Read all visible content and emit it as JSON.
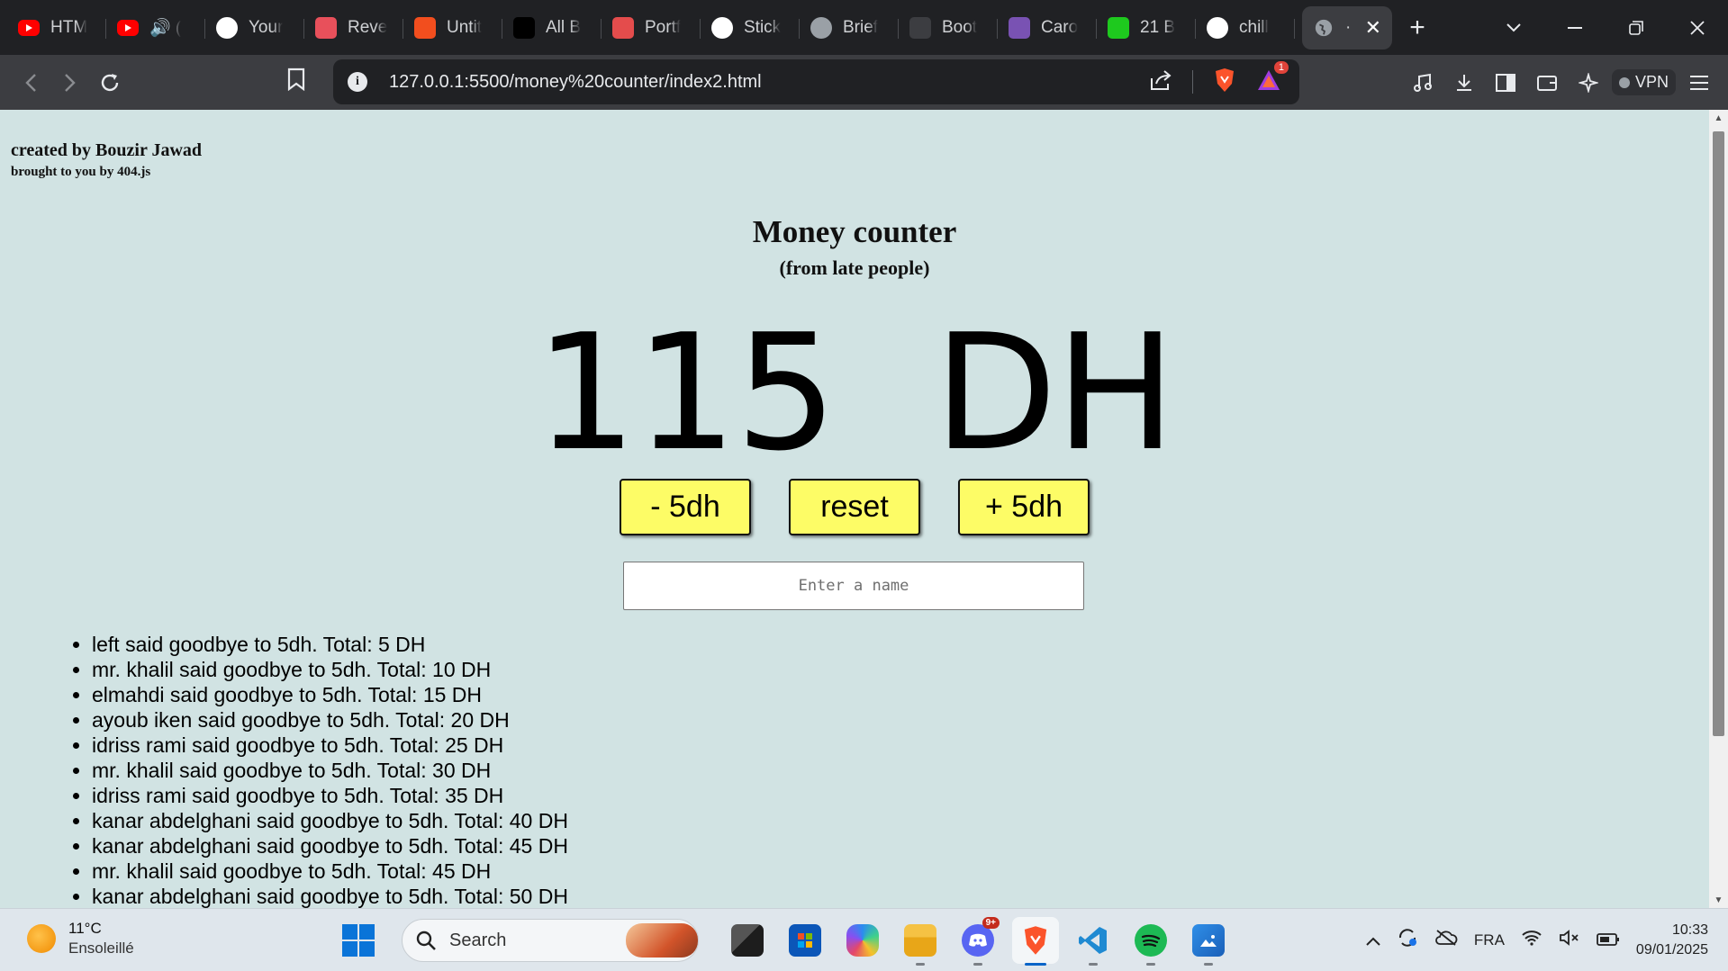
{
  "browser": {
    "tabs": [
      {
        "title": "HTM",
        "icon": "youtube-icon",
        "color": "#ff0000"
      },
      {
        "title": "🔊 (",
        "icon": "youtube-icon",
        "color": "#ff0000"
      },
      {
        "title": "Your",
        "icon": "github-icon",
        "color": "#ffffff"
      },
      {
        "title": "Reve",
        "icon": "app-icon",
        "color": "#e8505b"
      },
      {
        "title": "Untit",
        "icon": "figma-icon",
        "color": "#f24e1e"
      },
      {
        "title": "All B",
        "icon": "app-icon",
        "color": "#000000"
      },
      {
        "title": "Portf",
        "icon": "app-icon",
        "color": "#e44c4c"
      },
      {
        "title": "Stick",
        "icon": "chatgpt-icon",
        "color": "#ffffff"
      },
      {
        "title": "Brief",
        "icon": "globe-icon",
        "color": "#ffffff"
      },
      {
        "title": "Boot",
        "icon": "app-icon",
        "color": "#3c3d41"
      },
      {
        "title": "Caro",
        "icon": "bootstrap-icon",
        "color": "#7952b3"
      },
      {
        "title": "21 B",
        "icon": "app-icon",
        "color": "#1ec91e"
      },
      {
        "title": "chill",
        "icon": "google-icon",
        "color": "#ffffff"
      }
    ],
    "active_tab": {
      "title": "·",
      "icon": "globe-icon"
    },
    "url": "127.0.0.1:5500/money%20counter/index2.html",
    "shields_badge": "1",
    "vpn_label": "VPN"
  },
  "page": {
    "credit_line": "created by Bouzir Jawad",
    "brought_line": "brought to you by 404.js",
    "heading": "Money counter",
    "subheading": "(from late people)",
    "amount": "115  DH",
    "buttons": {
      "minus": "- 5dh",
      "reset": "reset",
      "plus": "+ 5dh"
    },
    "name_input": {
      "placeholder": "Enter a name",
      "value": ""
    },
    "log": [
      "left said goodbye to 5dh. Total: 5 DH",
      "mr. khalil said goodbye to 5dh. Total: 10 DH",
      "elmahdi said goodbye to 5dh. Total: 15 DH",
      "ayoub iken said goodbye to 5dh. Total: 20 DH",
      "idriss rami said goodbye to 5dh. Total: 25 DH",
      "mr. khalil said goodbye to 5dh. Total: 30 DH",
      "idriss rami said goodbye to 5dh. Total: 35 DH",
      "kanar abdelghani said goodbye to 5dh. Total: 40 DH",
      "kanar abdelghani said goodbye to 5dh. Total: 45 DH",
      "mr. khalil said goodbye to 5dh. Total: 45 DH",
      "kanar abdelghani said goodbye to 5dh. Total: 50 DH"
    ]
  },
  "taskbar": {
    "weather_temp": "11°C",
    "weather_desc": "Ensoleillé",
    "search_label": "Search",
    "discord_badge": "9+",
    "language": "FRA",
    "time": "10:33",
    "date": "09/01/2025"
  }
}
